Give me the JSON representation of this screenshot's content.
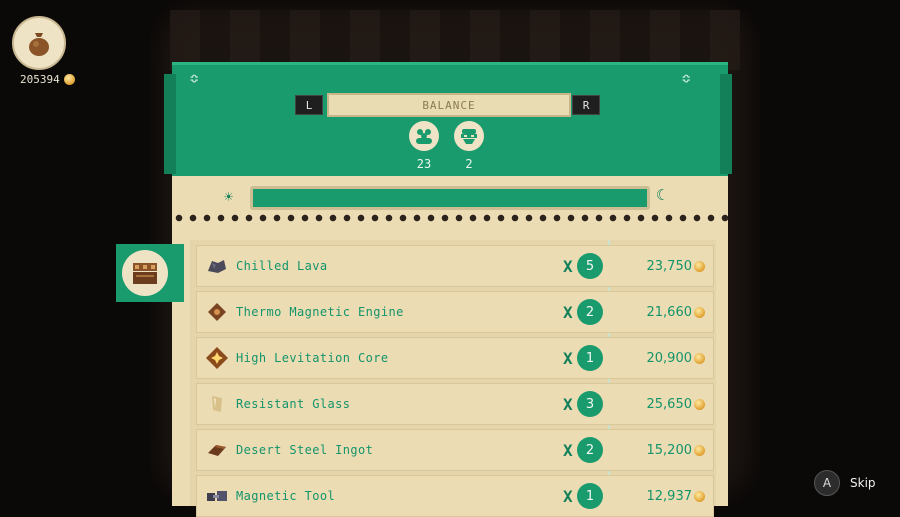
{
  "hud": {
    "money": "205394",
    "bag_icon": "money-bag-icon",
    "coin_icon": "coin-icon"
  },
  "header": {
    "left_button": "L",
    "title": "BALANCE",
    "right_button": "R",
    "stats": [
      {
        "icon": "customers-icon",
        "value": "23"
      },
      {
        "icon": "bandit-icon",
        "value": "2"
      }
    ]
  },
  "day_progress": {
    "sun_icon": "sun-icon",
    "moon_icon": "moon-icon",
    "fill_fraction": 1.0
  },
  "side_tab": {
    "icon": "shop-counter-icon"
  },
  "items": [
    {
      "name": "Chilled Lava",
      "qty": "5",
      "price": "23,750",
      "icon": "rock-icon"
    },
    {
      "name": "Thermo Magnetic Engine",
      "qty": "2",
      "price": "21,660",
      "icon": "engine-icon"
    },
    {
      "name": "High Levitation Core",
      "qty": "1",
      "price": "20,900",
      "icon": "core-icon"
    },
    {
      "name": "Resistant Glass",
      "qty": "3",
      "price": "25,650",
      "icon": "glass-icon"
    },
    {
      "name": "Desert Steel Ingot",
      "qty": "2",
      "price": "15,200",
      "icon": "ingot-icon"
    },
    {
      "name": "Magnetic Tool",
      "qty": "1",
      "price": "12,937",
      "icon": "tool-icon"
    }
  ],
  "multiply_symbol": "X",
  "footer": {
    "button": "A",
    "label": "Skip"
  },
  "colors": {
    "accent": "#1a9b6d",
    "paper": "#ecdcb4",
    "text": "#14946a"
  }
}
